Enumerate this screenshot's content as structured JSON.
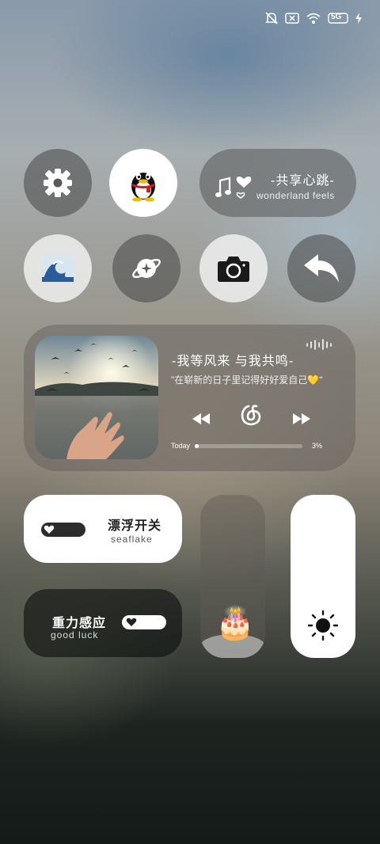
{
  "status_bar": {
    "icons": [
      "mute-icon",
      "sim-error-icon",
      "wifi-icon",
      "network-5g-icon",
      "charging-icon"
    ],
    "network_label": "5G"
  },
  "tiles": {
    "settings_icon": "gear-icon",
    "qq_icon": "qq-penguin-icon",
    "wave_icon": "wave-emoji-icon",
    "planet_icon": "planet-icon",
    "camera_icon": "camera-icon",
    "back_icon": "back-arrow-icon"
  },
  "music_card": {
    "title": "-共享心跳-",
    "subtitle": "wonderland feels"
  },
  "player": {
    "title": "-我等风来 与我共鸣-",
    "lyric": "\"在崭新的日子里记得好好爱自己💛\"",
    "progress_label": "Today",
    "progress_percent": "3%",
    "progress_value": 0.03
  },
  "float_switch": {
    "title": "漂浮开关",
    "subtitle": "seaflake"
  },
  "gravity_switch": {
    "title": "重力感应",
    "subtitle": "good luck"
  },
  "sliders": {
    "left_icon": "birthday-cake-icon",
    "cake_emoji": "🎂",
    "right_icon": "brightness-icon"
  },
  "colors": {
    "dark_tile": "#464646",
    "accent_white": "#ffffff"
  }
}
